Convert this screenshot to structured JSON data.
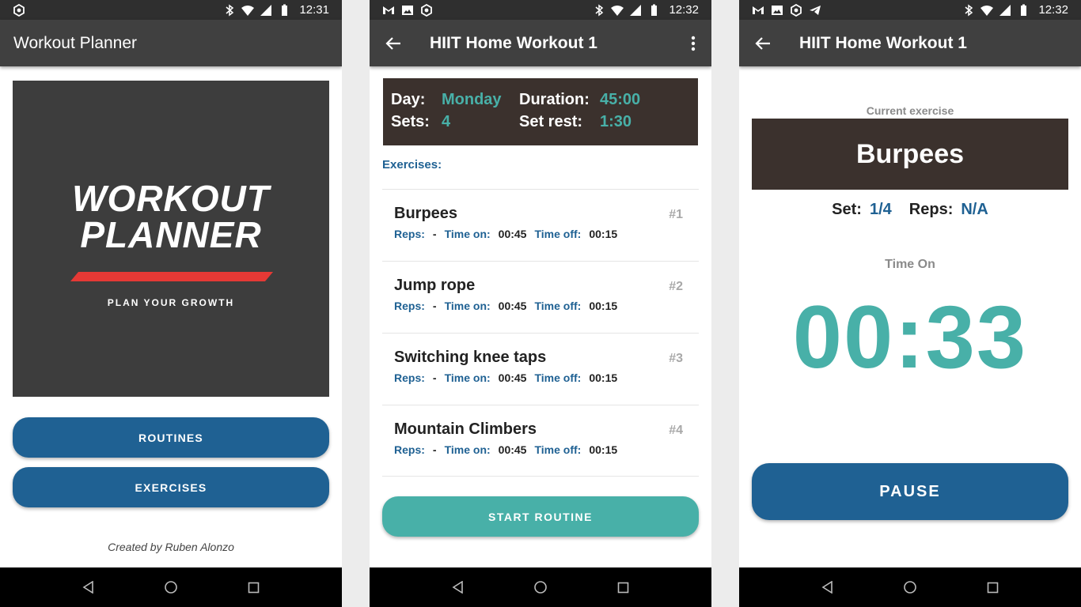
{
  "colors": {
    "primary": "#1f6193",
    "accent": "#48b0a8",
    "dark_box": "#3b312d",
    "appbar": "#404040",
    "logo_stripe": "#e53935"
  },
  "status_bars": [
    {
      "time": "12:31",
      "left_icons": [
        "app-icon"
      ]
    },
    {
      "time": "12:32",
      "left_icons": [
        "gmail-icon",
        "image-icon",
        "app-icon"
      ]
    },
    {
      "time": "12:32",
      "left_icons": [
        "gmail-icon",
        "image-icon",
        "app-icon",
        "telegram-icon"
      ]
    }
  ],
  "screen1": {
    "title": "Workout Planner",
    "logo": {
      "line1": "WORKOUT",
      "line2": "PLANNER",
      "tagline": "PLAN YOUR GROWTH"
    },
    "routines_button": "ROUTINES",
    "exercises_button": "EXERCISES",
    "credit": "Created by Ruben Alonzo"
  },
  "screen2": {
    "title": "HIIT Home Workout 1",
    "summary": {
      "day_label": "Day:",
      "day_value": "Monday",
      "duration_label": "Duration:",
      "duration_value": "45:00",
      "sets_label": "Sets:",
      "sets_value": "4",
      "set_rest_label": "Set rest:",
      "set_rest_value": "1:30"
    },
    "exercises_heading": "Exercises:",
    "exercises": [
      {
        "name": "Burpees",
        "num": "#1",
        "reps_label": "Reps:",
        "reps": "-",
        "on_label": "Time on:",
        "on": "00:45",
        "off_label": "Time off:",
        "off": "00:15"
      },
      {
        "name": "Jump rope",
        "num": "#2",
        "reps_label": "Reps:",
        "reps": "-",
        "on_label": "Time on:",
        "on": "00:45",
        "off_label": "Time off:",
        "off": "00:15"
      },
      {
        "name": "Switching knee taps",
        "num": "#3",
        "reps_label": "Reps:",
        "reps": "-",
        "on_label": "Time on:",
        "on": "00:45",
        "off_label": "Time off:",
        "off": "00:15"
      },
      {
        "name": "Mountain Climbers",
        "num": "#4",
        "reps_label": "Reps:",
        "reps": "-",
        "on_label": "Time on:",
        "on": "00:45",
        "off_label": "Time off:",
        "off": "00:15"
      }
    ],
    "start_button": "START ROUTINE"
  },
  "screen3": {
    "title": "HIIT Home Workout 1",
    "current_label": "Current exercise",
    "current_exercise": "Burpees",
    "set_label": "Set:",
    "set_value": "1/4",
    "reps_label": "Reps:",
    "reps_value": "N/A",
    "time_on_label": "Time On",
    "timer": "00:33",
    "pause_button": "PAUSE"
  }
}
